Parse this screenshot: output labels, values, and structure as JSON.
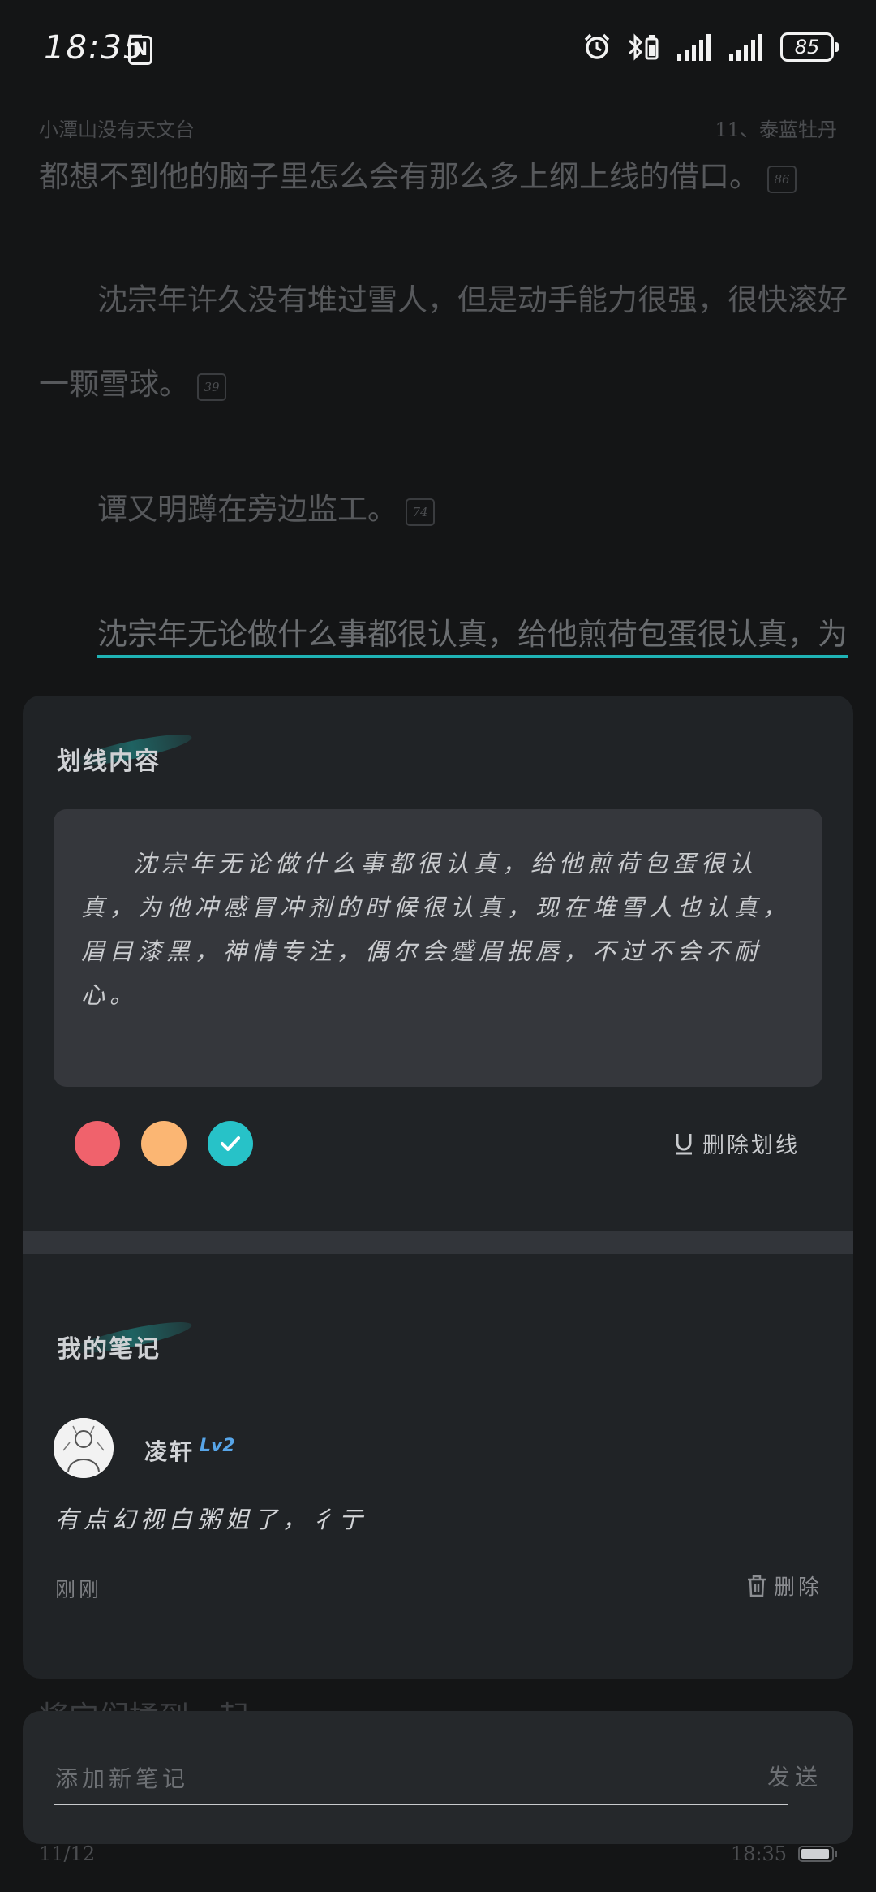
{
  "status_bar": {
    "time": "18:35",
    "nfc": "N",
    "battery": "85"
  },
  "reader": {
    "book_title": "小潭山没有天文台",
    "chapter": "11、泰蓝牡丹",
    "line1": "都想不到他的脑子里怎么会有那么多上纲上线的借口。",
    "line1_badge": "86",
    "para2_line1": "沈宗年许久没有堆过雪人，但是动手能力很强，很快滚好",
    "para2_line2": "一颗雪球。",
    "para2_badge": "39",
    "para3": "谭又明蹲在旁边监工。",
    "para3_badge": "74",
    "para4_highlight": "沈宗年无论做什么事都很认真，给他煎荷包蛋很认真，为",
    "behind_text": "将它们揉到一起，"
  },
  "highlight_panel": {
    "title": "划线内容",
    "quote": "沈宗年无论做什么事都很认真，给他煎荷包蛋很认真，为他冲感冒冲剂的时候很认真，现在堆雪人也认真，眉目漆黑，神情专注，偶尔会蹙眉抿唇，不过不会不耐心。",
    "colors": [
      "#f0626c",
      "#fbb673",
      "#27c2c8"
    ],
    "selected_color": "#27c2c8",
    "delete_label": "删除划线"
  },
  "notes_panel": {
    "title": "我的笔记",
    "user_name": "凌轩",
    "user_level": "Lv2",
    "note_text": "有点幻视白粥姐了，彳亍",
    "time": "刚刚",
    "delete_label": "删除"
  },
  "compose": {
    "placeholder": "添加新笔记",
    "send_label": "发送"
  },
  "footer": {
    "page": "11/12",
    "time": "18:35"
  }
}
